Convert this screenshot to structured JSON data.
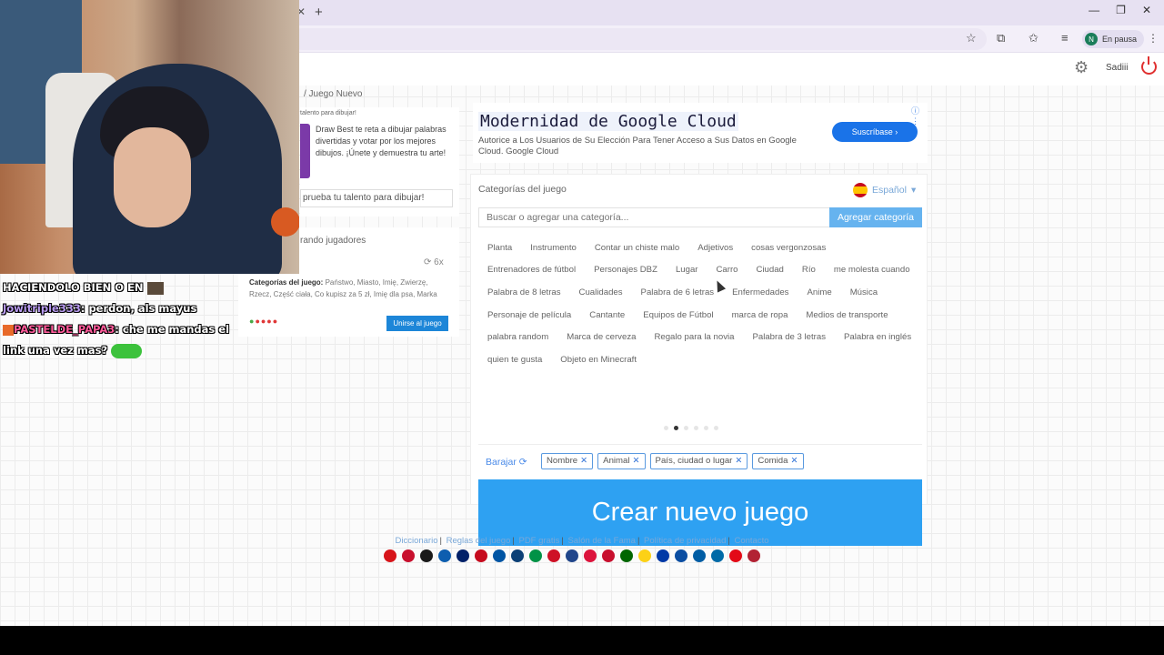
{
  "browser": {
    "close_tab": "✕",
    "new_tab": "+",
    "window_controls": [
      "—",
      "❐",
      "✕"
    ],
    "profile_initial": "N",
    "profile_status": "En pausa"
  },
  "header": {
    "username": "Sadiii"
  },
  "breadcrumb": "/ Juego Nuevo",
  "promo": {
    "title": "talento para dibujar!",
    "text": "Draw Best te reta a dibujar palabras divertidas y votar por los mejores dibujos. ¡Únete y demuestra tu arte!",
    "input_text": "prueba tu talento para dibujar!"
  },
  "players": {
    "title": "rando jugadores",
    "count": "6x",
    "categories_label": "Categorías del juego:",
    "categories_text": "Państwo, Miasto, Imię, Zwierzę, Rzecz, Część ciała, Co kupisz za 5 zł, Imię dla psa, Marka",
    "dots": "●●●●●",
    "join_button": "Unirse al juego"
  },
  "chat": {
    "line1": "HACIENDOLO BIEN O EN",
    "user1": "Jowitriple333",
    "msg1": ": perdon, als mayus",
    "user2": "PASTELDE_PAPA3",
    "msg2": ": che me mandas el link una vez mas?"
  },
  "ad": {
    "title": "Modernidad de Google Cloud",
    "description": "Autorice a Los Usuarios de Su Elección Para Tener Acceso a Sus Datos en Google Cloud. Google Cloud",
    "button": "Suscríbase",
    "info": "ⓘ ⋮"
  },
  "categories": {
    "title": "Categorías del juego",
    "language": "Español",
    "search_placeholder": "Buscar o agregar una categoría...",
    "add_button": "Agregar categoría",
    "rows": [
      [
        "Planta",
        "Instrumento",
        "Contar un chiste malo",
        "Adjetivos",
        "cosas vergonzosas"
      ],
      [
        "Entrenadores de fútbol",
        "Personajes DBZ",
        "Lugar",
        "Carro",
        "Ciudad",
        "Río",
        "me molesta cuando"
      ],
      [
        "Palabra de 8 letras",
        "Cualidades",
        "Palabra de 6 letras",
        "Enfermedades",
        "Anime",
        "Música"
      ],
      [
        "Personaje de película",
        "Cantante",
        "Equipos de Fútbol",
        "marca de ropa",
        "Medios de transporte"
      ],
      [
        "palabra random",
        "Marca de cerveza",
        "Regalo para la novia",
        "Palabra de 3 letras",
        "Palabra en inglés"
      ],
      [
        "quien te gusta",
        "Objeto en Minecraft"
      ]
    ],
    "shuffle": "Barajar",
    "selected": [
      "Nombre",
      "Animal",
      "País, ciudad o lugar",
      "Comida"
    ],
    "create_button": "Crear nuevo juego"
  },
  "footer": {
    "links": [
      "Diccionario",
      "Reglas del juego",
      "PDF gratis",
      "Salón de la Fama",
      "Política de privacidad",
      "Contacto"
    ],
    "flag_colors": [
      "#d7141a",
      "#c8102e",
      "#1a1a1a",
      "#0d5eaf",
      "#012169",
      "#c60b1e",
      "#0055a4",
      "#0c4076",
      "#009246",
      "#ce1126",
      "#21468b",
      "#dc143c",
      "#c8102e",
      "#006600",
      "#fcd116",
      "#0039a6",
      "#0b4ea2",
      "#005da4",
      "#006aa7",
      "#e30a17",
      "#b22234"
    ]
  }
}
